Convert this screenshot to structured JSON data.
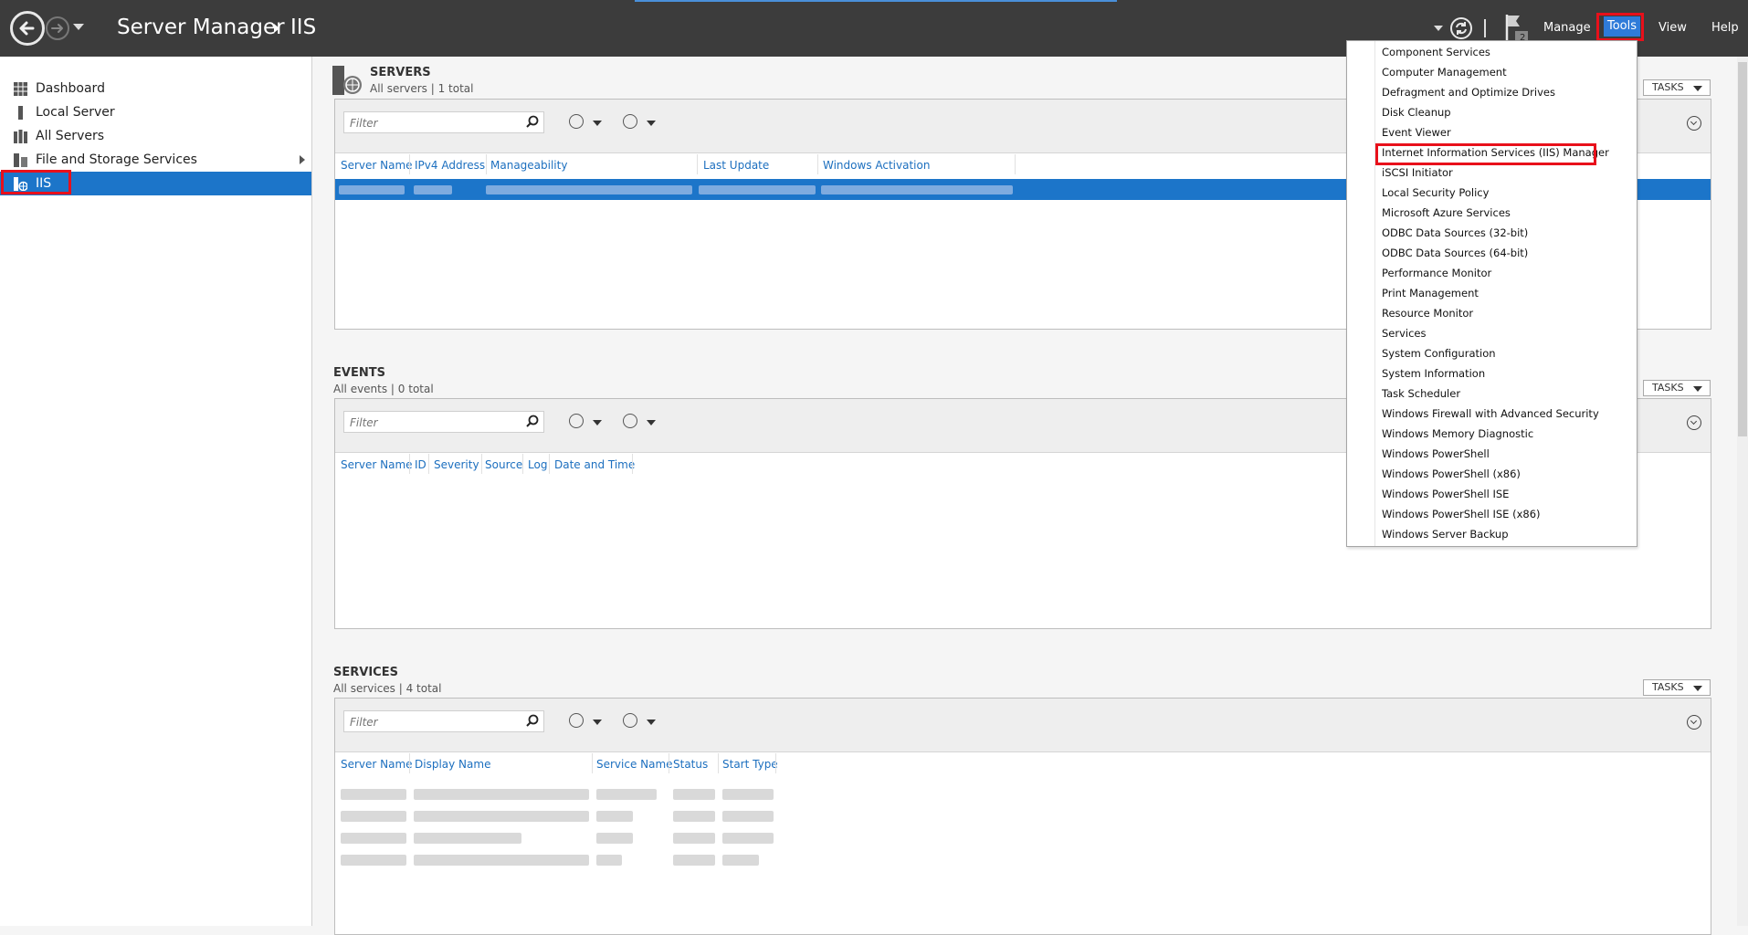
{
  "titlebar": {
    "app_title": "Server Manager",
    "crumb": "IIS",
    "menu": {
      "manage": "Manage",
      "tools": "Tools",
      "view": "View",
      "help": "Help"
    },
    "flag_count": "2",
    "icons": [
      "back-arrow-icon",
      "forward-arrow-icon",
      "refresh-icon",
      "flag-icon"
    ]
  },
  "sidebar": {
    "items": [
      {
        "label": "Dashboard",
        "icon": "dashboard-icon"
      },
      {
        "label": "Local Server",
        "icon": "server-icon"
      },
      {
        "label": "All Servers",
        "icon": "servers-icon"
      },
      {
        "label": "File and Storage Services",
        "icon": "storage-icon"
      },
      {
        "label": "IIS",
        "icon": "iis-icon"
      }
    ],
    "selected": "IIS"
  },
  "servers": {
    "title": "SERVERS",
    "subtitle": "All servers | 1 total",
    "tasks": "TASKS",
    "filter_placeholder": "Filter",
    "columns": [
      "Server Name",
      "IPv4 Address",
      "Manageability",
      "Last Update",
      "Windows Activation"
    ]
  },
  "events": {
    "title": "EVENTS",
    "subtitle": "All events | 0 total",
    "tasks": "TASKS",
    "filter_placeholder": "Filter",
    "columns": [
      "Server Name",
      "ID",
      "Severity",
      "Source",
      "Log",
      "Date and Time"
    ]
  },
  "services": {
    "title": "SERVICES",
    "subtitle": "All services | 4 total",
    "tasks": "TASKS",
    "filter_placeholder": "Filter",
    "columns": [
      "Server Name",
      "Display Name",
      "Service Name",
      "Status",
      "Start Type"
    ]
  },
  "tools_menu": {
    "items": [
      "Component Services",
      "Computer Management",
      "Defragment and Optimize Drives",
      "Disk Cleanup",
      "Event Viewer",
      "Internet Information Services (IIS) Manager",
      "iSCSI Initiator",
      "Local Security Policy",
      "Microsoft Azure Services",
      "ODBC Data Sources (32-bit)",
      "ODBC Data Sources (64-bit)",
      "Performance Monitor",
      "Print Management",
      "Resource Monitor",
      "Services",
      "System Configuration",
      "System Information",
      "Task Scheduler",
      "Windows Firewall with Advanced Security",
      "Windows Memory Diagnostic",
      "Windows PowerShell",
      "Windows PowerShell (x86)",
      "Windows PowerShell ISE",
      "Windows PowerShell ISE (x86)",
      "Windows Server Backup"
    ],
    "highlighted": "Internet Information Services (IIS) Manager"
  },
  "colors": {
    "titlebar": "#3c3c3c",
    "selection": "#1c75c9",
    "highlight_box": "#e8101b",
    "link": "#1c6fbf"
  }
}
